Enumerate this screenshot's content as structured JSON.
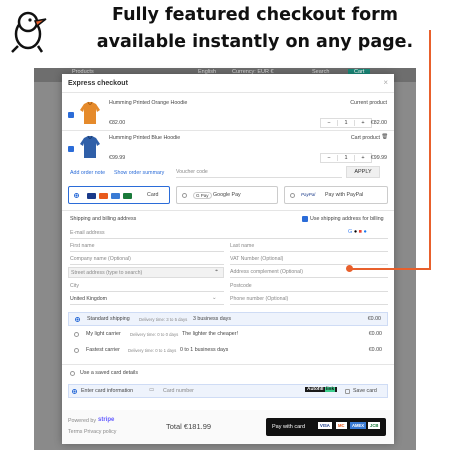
{
  "banner": {
    "title_line1": "Fully featured checkout form",
    "title_line2": "available instantly on any page."
  },
  "background": {
    "left_text": "Products",
    "lang": "English",
    "currency": "Currency: EUR €",
    "search": "Search",
    "cart": "Cart"
  },
  "modal": {
    "title": "Express checkout",
    "products": [
      {
        "name": "Humming Printed Orange Hoodie",
        "status": "Current product",
        "price": "€82.00",
        "qty": "1",
        "total": "€82.00",
        "color": "#e58a2b"
      },
      {
        "name": "Humming Printed Blue Hoodie",
        "status": "Cart product",
        "price": "€99.99",
        "qty": "1",
        "total": "€99.99",
        "color": "#2f5fa8"
      }
    ],
    "links": {
      "add_order_note": "Add order note",
      "show_order_summary": "Show order summary"
    },
    "voucher": {
      "placeholder": "Voucher code",
      "apply": "APPLY"
    },
    "payment_methods": {
      "card": "Card",
      "google_pay": "Google Pay",
      "paypal": "Pay with PayPal",
      "gpay_badge": "G Pay",
      "paypal_badge": "PayPal"
    },
    "shipping": {
      "section_title": "Shipping and billing address",
      "same_address": "Use shipping address for billing",
      "email": "E-mail address",
      "first_name": "First name",
      "last_name": "Last name",
      "company": "Company name (Optional)",
      "vat": "VAT Number (Optional)",
      "street": "Street address (type to search)",
      "complement": "Address complement (Optional)",
      "city": "City",
      "postcode": "Postcode",
      "country": "United Kingdom",
      "phone": "Phone number (Optional)"
    },
    "carriers": [
      {
        "name": "Standard shipping",
        "delivery": "Delivery time: 3 to 5 days",
        "note": "3 business days",
        "price": "€0.00",
        "selected": true
      },
      {
        "name": "My light carrier",
        "delivery": "Delivery time: 0 to 0 days",
        "note": "The lighter the cheaper!",
        "price": "€0.00",
        "selected": false
      },
      {
        "name": "Fastest carrier",
        "delivery": "Delivery time: 0 to 1 days",
        "note": "0 to 1 business days",
        "price": "€0.00",
        "selected": false
      }
    ],
    "card": {
      "saved": "Use a saved card details",
      "enter": "Enter card information",
      "number_placeholder": "Card number",
      "autofill": "Autofill",
      "autofill_link": "link",
      "save_card": "Save card"
    },
    "footer": {
      "powered_by": "Powered by",
      "stripe": "stripe",
      "terms": "Terms",
      "privacy": "Privacy policy",
      "total_label": "Total €181.99",
      "pay_with_card": "Pay with card",
      "card_brands": [
        "VISA",
        "MC",
        "AMEX",
        "JCB"
      ]
    }
  },
  "colors": {
    "accent": "#2b6cd8",
    "annotation": "#e8602c",
    "pay_button": "#111111"
  }
}
